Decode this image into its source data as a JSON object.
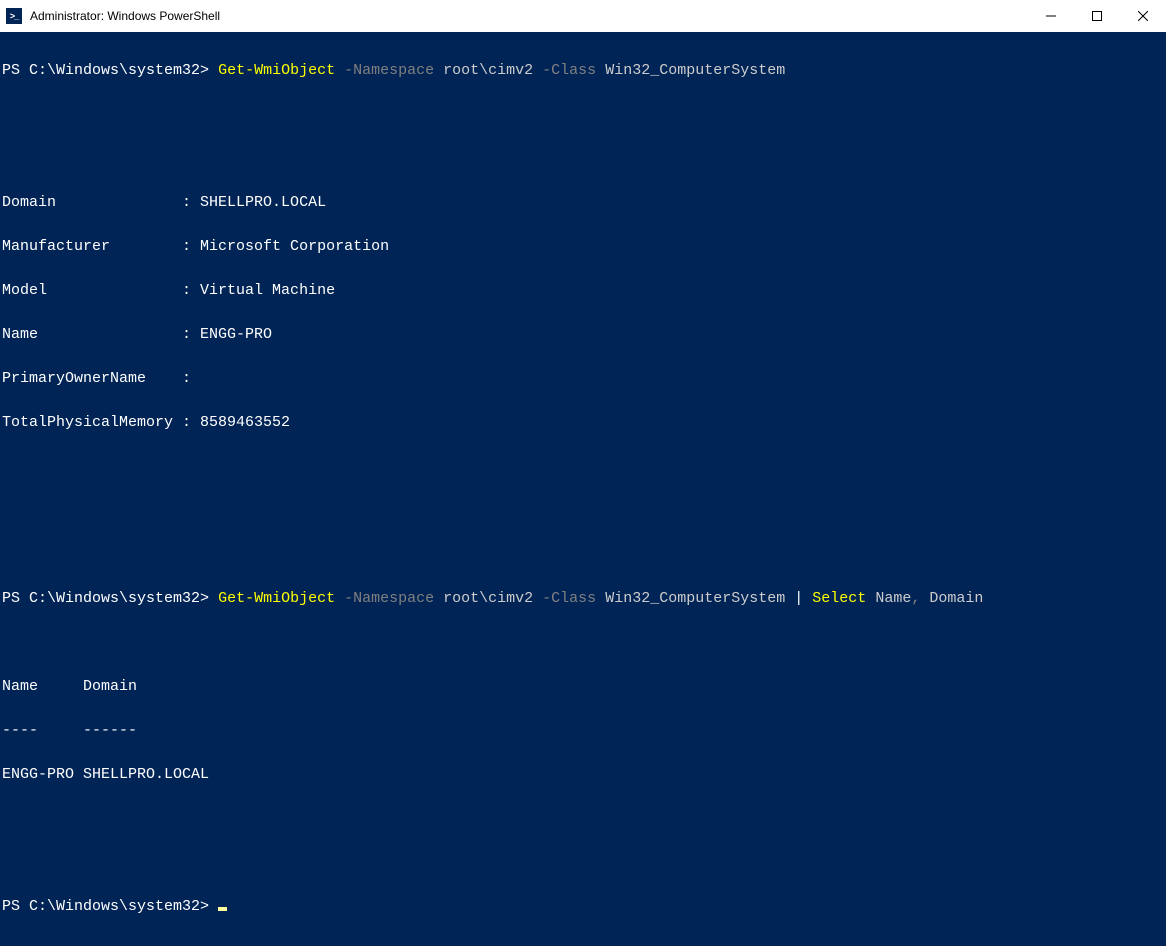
{
  "titlebar": {
    "title": "Administrator: Windows PowerShell"
  },
  "terminal": {
    "prompt": "PS C:\\Windows\\system32>",
    "cmd1": {
      "cmdlet": "Get-WmiObject",
      "param1": "-Namespace",
      "arg1": "root\\cimv2",
      "param2": "-Class",
      "arg2": "Win32_ComputerSystem"
    },
    "output1": {
      "rows": [
        {
          "label": "Domain",
          "value": "SHELLPRO.LOCAL"
        },
        {
          "label": "Manufacturer",
          "value": "Microsoft Corporation"
        },
        {
          "label": "Model",
          "value": "Virtual Machine"
        },
        {
          "label": "Name",
          "value": "ENGG-PRO"
        },
        {
          "label": "PrimaryOwnerName",
          "value": ""
        },
        {
          "label": "TotalPhysicalMemory",
          "value": "8589463552"
        }
      ]
    },
    "cmd2": {
      "cmdlet": "Get-WmiObject",
      "param1": "-Namespace",
      "arg1": "root\\cimv2",
      "param2": "-Class",
      "arg2": "Win32_ComputerSystem",
      "pipe": "|",
      "cmdlet2": "Select",
      "col1": "Name",
      "comma": ",",
      "col2": "Domain"
    },
    "output2": {
      "header_name": "Name",
      "header_domain": "Domain",
      "sep_name": "----",
      "sep_domain": "------",
      "row_name": "ENGG-PRO",
      "row_domain": "SHELLPRO.LOCAL"
    }
  }
}
